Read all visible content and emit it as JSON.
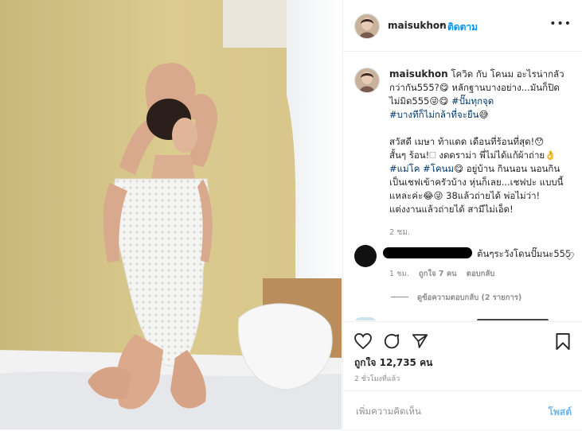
{
  "post": {
    "username": "maisukhon",
    "follow_label": "ติดตาม",
    "more_label": "•••",
    "caption": {
      "username": "maisukhon",
      "line1": "โควิด กับ โคนม อะไรน่ากลัว",
      "line2": "กว่ากัน555?😋 หลักฐานบางอย่าง...มันก็ปิด",
      "line3a": "ไม่มิด555😜😋 ",
      "tag1": "#ปั๊มทุกจุด",
      "tag2": "#บางทีก็ไม่กล้าที่จะยืน",
      "line4": "😅",
      "para2_l1": "สวัสดี เมษา ท้าแดด เดือนที่ร้อนที่สุด!😯",
      "para2_l2": "สั้นๆ ร้อน!🗆 งดดราม่า พี่ไม่ได้แก้ผ้าถ่าย👌",
      "tag3": "#แม่โค",
      "tag4": "#โคนม",
      "para2_l3rest": "😋 อยู่บ้าน กินนอน นอนกิน",
      "para2_l4": "เป็นเชฟเข้าครัวบ้าง หุ่นก็เลย...เชฟปะ แบบนี้",
      "para2_l5": "แหละค่ะ😂😜 38แล้วถ่ายได้ พ่อไม่ว่า!",
      "para2_l6": "แต่งงานแล้วถ่ายได้ สามีไม่เอ็ด!",
      "time": "2 ชม."
    },
    "comment": {
      "text": "ต้นๆระวังโดนปั๊มนะ555",
      "time": "1 ชม.",
      "likes": "ถูกใจ 7 คน",
      "reply_label": "ตอบกลับ",
      "view_replies": "ดูข้อความตอบกลับ (2 รายการ)"
    },
    "likes_text": "ถูกใจ 12,735 คน",
    "time_ago": "2 ชั่วโมงที่แล้ว",
    "comment_input_placeholder": "เพิ่มความคิดเห็น",
    "post_button": "โพสต์"
  }
}
